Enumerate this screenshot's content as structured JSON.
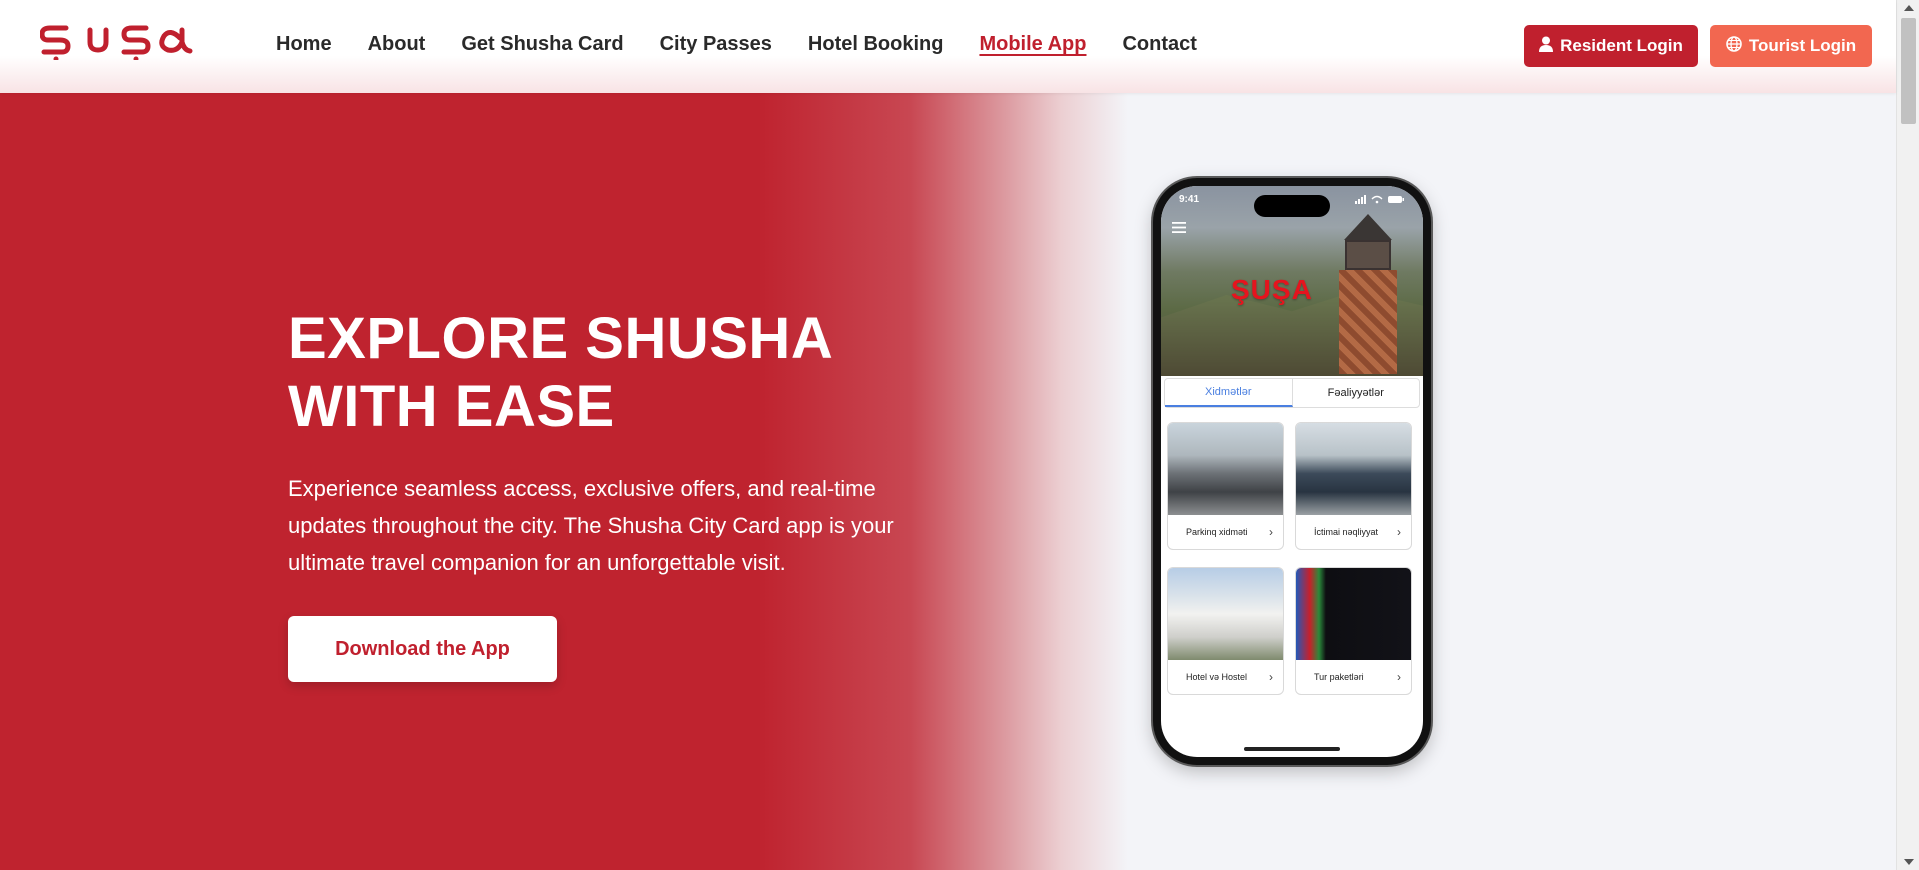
{
  "header": {
    "logo_text": "ŞUŞA",
    "nav": [
      {
        "label": "Home",
        "active": false
      },
      {
        "label": "About",
        "active": false
      },
      {
        "label": "Get Shusha Card",
        "active": false
      },
      {
        "label": "City Passes",
        "active": false
      },
      {
        "label": "Hotel Booking",
        "active": false
      },
      {
        "label": "Mobile App",
        "active": true
      },
      {
        "label": "Contact",
        "active": false
      }
    ],
    "resident_login": "Resident Login",
    "tourist_login": "Tourist Login"
  },
  "hero": {
    "title_line1": "EXPLORE SHUSHA",
    "title_line2": "WITH EASE",
    "description": "Experience seamless access, exclusive offers, and real-time updates throughout the city. The Shusha City Card app is your ultimate travel companion for an unforgettable visit.",
    "download_button": "Download the App"
  },
  "phone": {
    "time": "9:41",
    "logo_text": "ŞUŞA",
    "tabs": [
      {
        "label": "Xidmətlər",
        "active": true
      },
      {
        "label": "Fəaliyyətlər",
        "active": false
      }
    ],
    "cards": [
      {
        "label": "Parkinq xidməti"
      },
      {
        "label": "İctimai nəqliyyat"
      },
      {
        "label": "Hotel və Hostel"
      },
      {
        "label": "Tur paketləri"
      }
    ]
  },
  "colors": {
    "brand_red": "#c0202e",
    "tourist_orange": "#f26750",
    "tab_blue": "#4a7fe0"
  }
}
